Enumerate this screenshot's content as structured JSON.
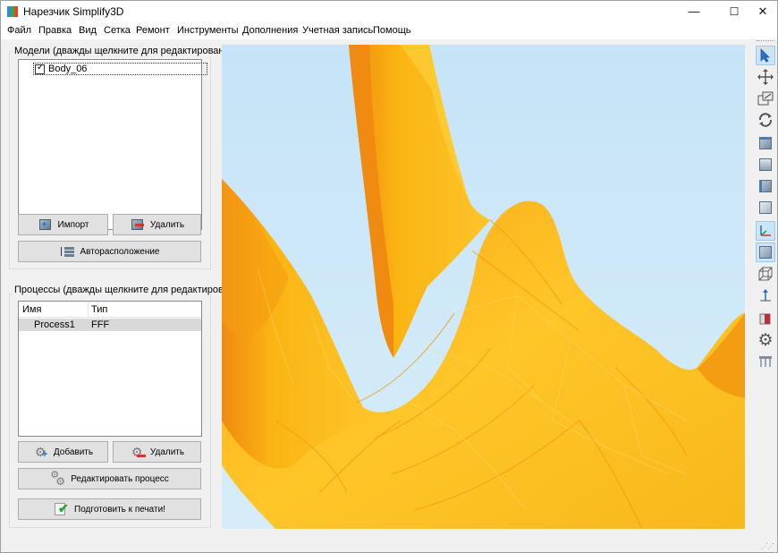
{
  "window": {
    "title": "Нарезчик Simplify3D",
    "minimize": "—",
    "maximize": "☐",
    "close": "✕"
  },
  "menu": [
    "Файл",
    "Правка",
    "Вид",
    "Сетка",
    "Ремонт",
    "Инструменты",
    "Дополнения",
    "Учетная запись",
    "Помощь"
  ],
  "models": {
    "group_title": "Модели (дважды щелкните для редактирования)",
    "items": [
      {
        "name": "Body_06",
        "checked": true
      }
    ],
    "import_label": "Импорт",
    "delete_label": "Удалить",
    "auto_arrange_label": "Авторасположение"
  },
  "processes": {
    "group_title": "Процессы (дважды щелкните для редактирования)",
    "columns": [
      "Имя",
      "Тип"
    ],
    "rows": [
      {
        "name": "Process1",
        "type": "FFF"
      }
    ],
    "add_label": "Добавить",
    "delete_label": "Удалить",
    "edit_label": "Редактировать процесс",
    "prepare_label": "Подготовить к печати!"
  },
  "toolbar": [
    "select-arrow-icon",
    "move-icon",
    "scale-icon",
    "rotate-icon",
    "view-top-cube-icon",
    "view-front-cube-icon",
    "view-side-cube-icon",
    "view-iso-cube-icon",
    "axes-icon",
    "solid-cube-icon",
    "wireframe-cube-icon",
    "z-axis-icon",
    "cross-section-icon",
    "settings-gear-icon",
    "supports-icon"
  ],
  "colors": {
    "sky_top": "#c6e4f8",
    "sky_bottom": "#d4ecf8",
    "model_main": "#fbb513",
    "model_dark": "#f08a10",
    "model_light": "#ffcf33",
    "selection_row": "#d9d9d9"
  }
}
